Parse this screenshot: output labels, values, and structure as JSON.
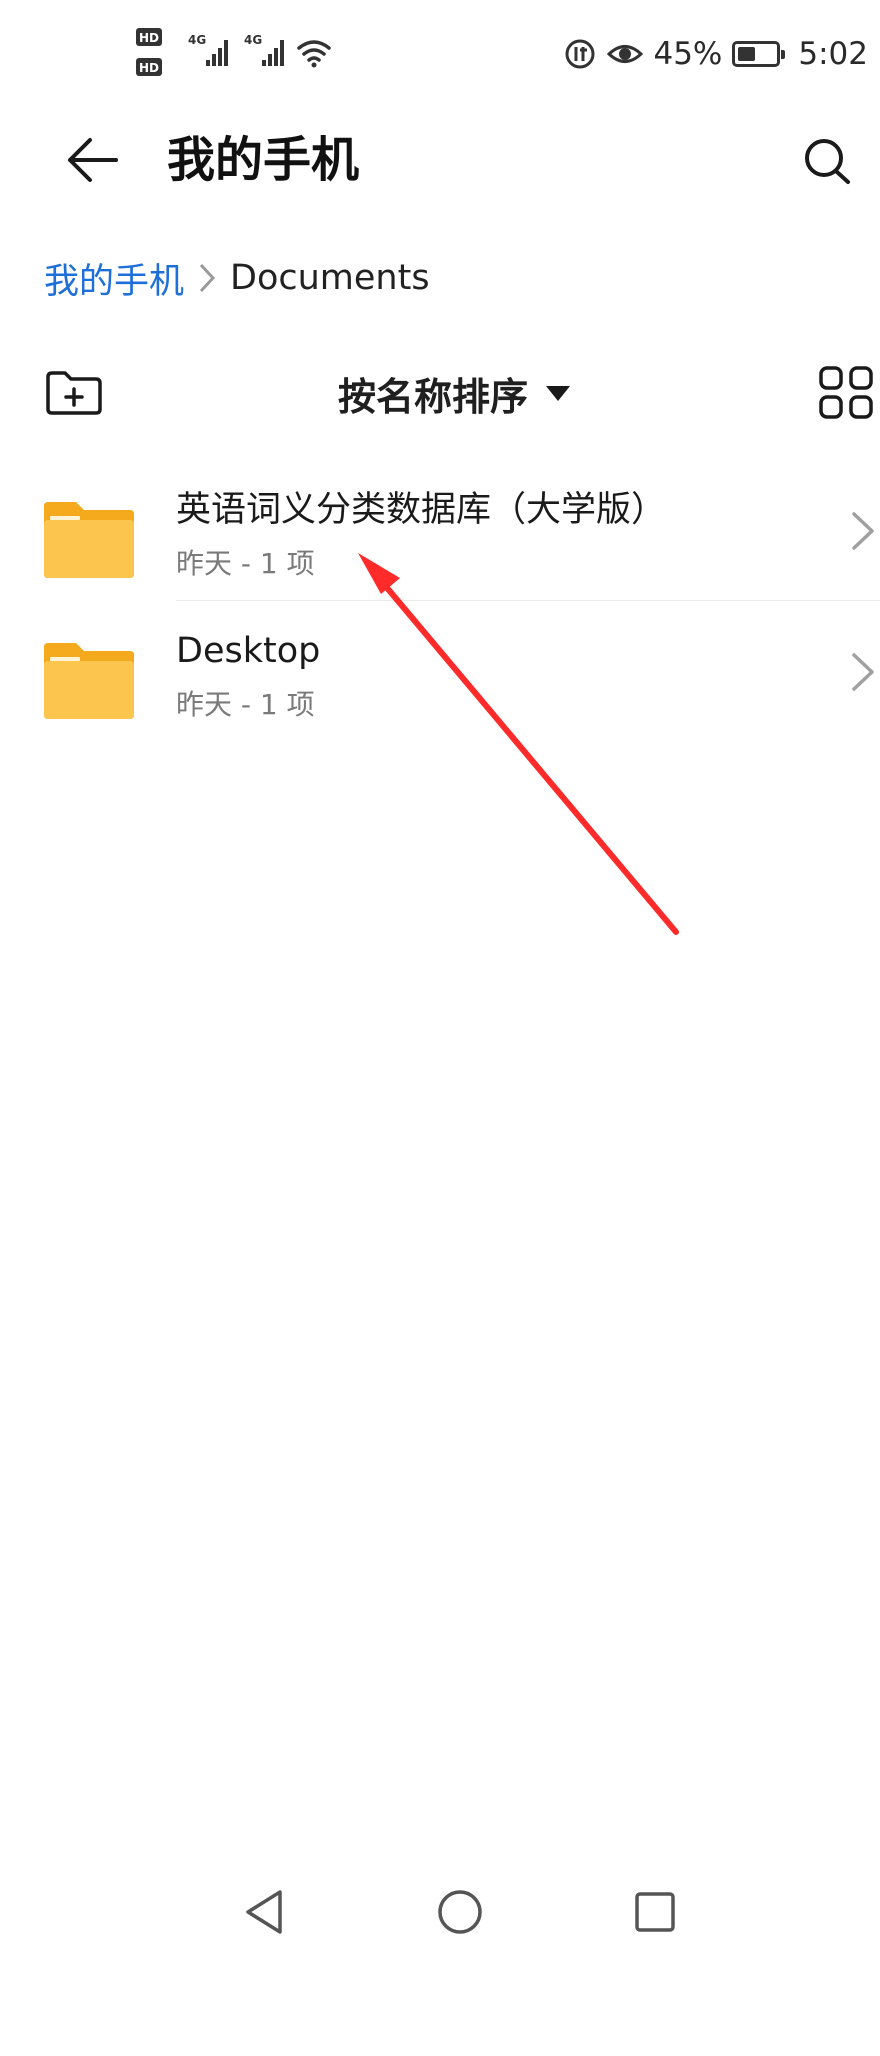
{
  "status_bar": {
    "sim1": "HD 1",
    "sim2": "HD 2",
    "network1": "4G",
    "network2": "4G",
    "battery_percent": "45%",
    "battery_level": 0.45,
    "time": "5:02",
    "icons": [
      "hd-1-icon",
      "hd-2-icon",
      "signal-4g-icon",
      "signal-4g-icon",
      "wifi-icon",
      "data-saver-icon",
      "eye-comfort-icon",
      "battery-icon"
    ]
  },
  "header": {
    "title": "我的手机",
    "back_icon": "arrow-left-icon",
    "search_icon": "search-icon"
  },
  "breadcrumb": {
    "root": "我的手机",
    "current": "Documents"
  },
  "toolbar": {
    "new_folder_icon": "new-folder-icon",
    "sort_label": "按名称排序",
    "view_icon": "grid-view-icon"
  },
  "files": [
    {
      "name": "英语词义分类数据库（大学版）",
      "meta": "昨天 - 1 项",
      "icon": "folder-icon"
    },
    {
      "name": "Desktop",
      "meta": "昨天 - 1 项",
      "icon": "folder-icon"
    }
  ],
  "nav_bar": {
    "back_icon": "nav-back-icon",
    "home_icon": "nav-home-icon",
    "recents_icon": "nav-recents-icon"
  },
  "colors": {
    "accent": "#1f6fd8",
    "folder": "#fcc54e",
    "folder_tab": "#f5a91c",
    "annotation": "#ff2a2a"
  }
}
